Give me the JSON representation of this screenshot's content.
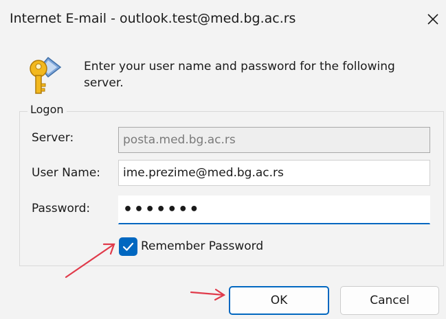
{
  "window": {
    "title": "Internet E-mail - outlook.test@med.bg.ac.rs"
  },
  "message": {
    "text": "Enter your user name and password for the following server."
  },
  "logon": {
    "legend": "Logon",
    "server_label": "Server:",
    "server_value": "posta.med.bg.ac.rs",
    "username_label": "User Name:",
    "username_value": "ime.prezime@med.bg.ac.rs",
    "password_label": "Password:",
    "password_value": "•••••••",
    "remember_label": "Remember Password",
    "remember_checked": true
  },
  "buttons": {
    "ok_label": "OK",
    "cancel_label": "Cancel"
  },
  "colors": {
    "accent": "#0067c0",
    "annotation_arrow": "#e03a4a"
  },
  "icons": {
    "keys": "keys-icon",
    "close": "close-icon",
    "check": "checkmark-icon"
  }
}
